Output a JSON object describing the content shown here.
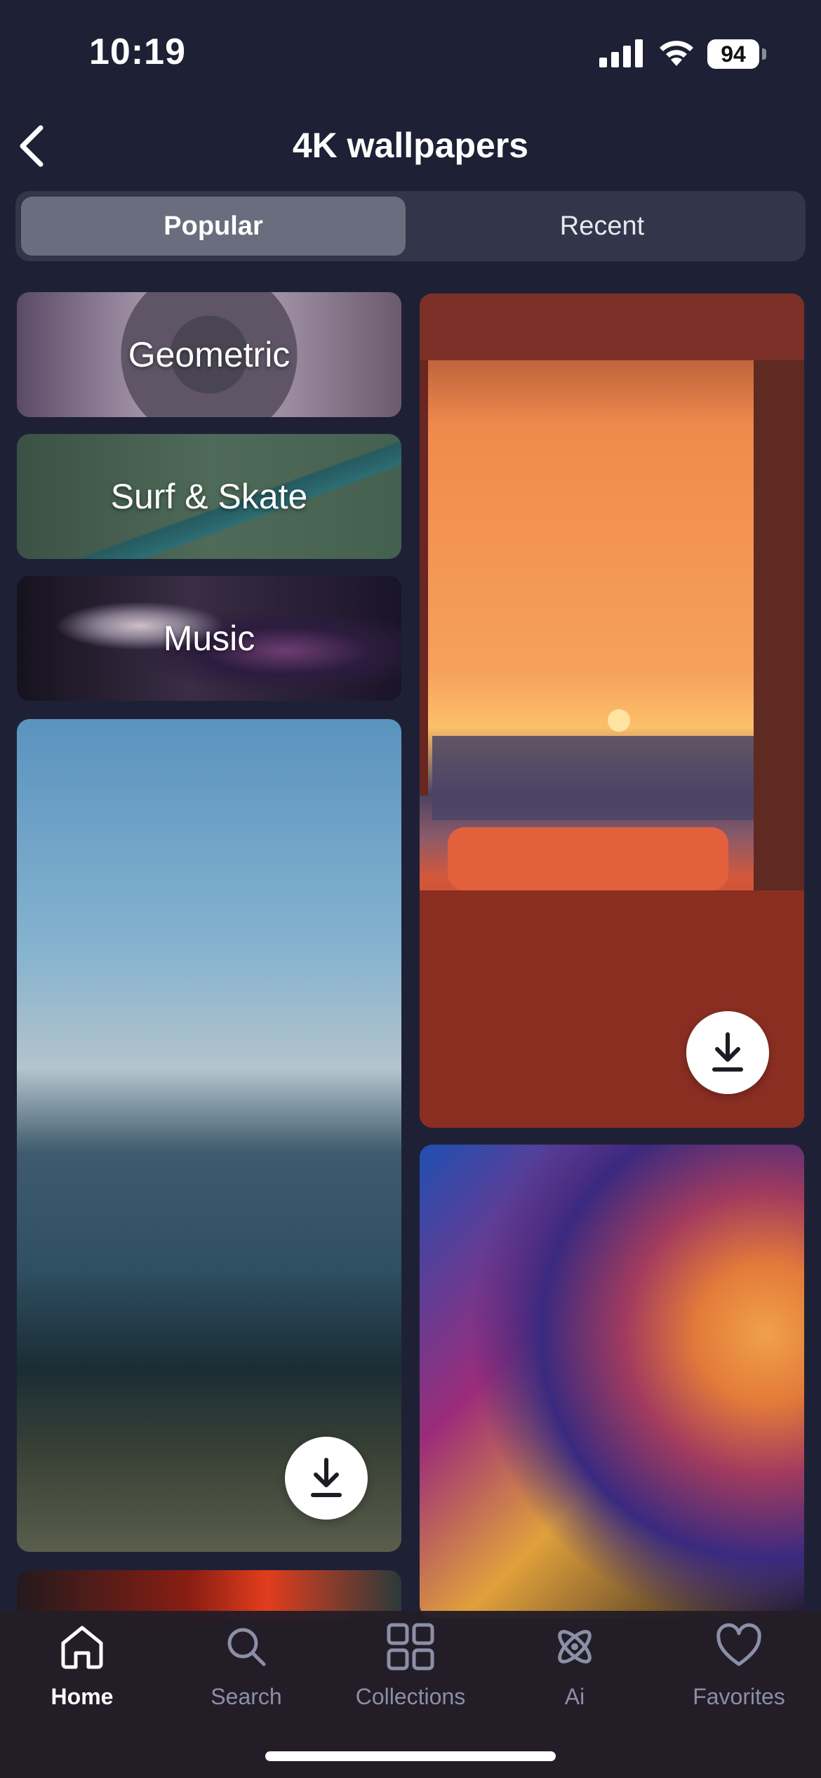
{
  "status_bar": {
    "time": "10:19",
    "battery": "94"
  },
  "header": {
    "title": "4K wallpapers"
  },
  "segments": [
    {
      "label": "Popular",
      "active": true
    },
    {
      "label": "Recent",
      "active": false
    }
  ],
  "categories": [
    {
      "label": "Geometric"
    },
    {
      "label": "Surf & Skate"
    },
    {
      "label": "Music"
    }
  ],
  "tabs": [
    {
      "label": "Home",
      "icon": "home-icon",
      "active": true
    },
    {
      "label": "Search",
      "icon": "search-icon",
      "active": false
    },
    {
      "label": "Collections",
      "icon": "grid-icon",
      "active": false
    },
    {
      "label": "Ai",
      "icon": "atom-icon",
      "active": false
    },
    {
      "label": "Favorites",
      "icon": "heart-icon",
      "active": false
    }
  ],
  "colors": {
    "background": "#1e2135",
    "segment_active": "#6a6d7e",
    "tab_inactive": "#8b8fa8"
  }
}
